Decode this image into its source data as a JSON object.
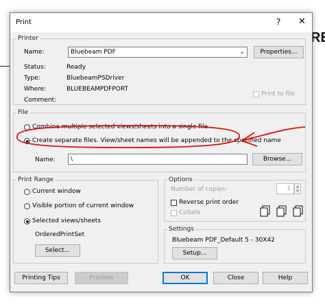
{
  "background": {
    "heading_fragment": "RE"
  },
  "dialog": {
    "title": "Print",
    "help_glyph": "?",
    "close_glyph": "✕"
  },
  "printer": {
    "legend": "Printer",
    "name_label": "Name:",
    "name_value": "Bluebeam PDF",
    "properties_label": "Properties...",
    "status_label": "Status:",
    "status_value": "Ready",
    "type_label": "Type:",
    "type_value": "BluebeamPSDriver",
    "where_label": "Where:",
    "where_value": "BLUEBEAMPDFPORT",
    "comment_label": "Comment:",
    "print_to_file_label": "Print to file"
  },
  "file": {
    "legend": "File",
    "combine_label": "Combine multiple selected views/sheets into a single file",
    "separate_label": "Create separate files. View/sheet names will be appended to the specified name",
    "selected": "separate",
    "path_value": "\\",
    "name_field_label": "Name:",
    "browse_label": "Browse...",
    "annotation_color": "#e01010"
  },
  "print_range": {
    "legend": "Print Range",
    "current_window": "Current window",
    "visible_portion": "Visible portion of current window",
    "selected_views": "Selected views/sheets",
    "selected": "selected_views",
    "set_name": "OrderedPrintSet",
    "select_label": "Select..."
  },
  "options": {
    "legend": "Options",
    "copies_label": "Number of copies:",
    "copies_value": "1",
    "reverse_label": "Reverse print order",
    "collate_label": "Collate"
  },
  "settings": {
    "legend": "Settings",
    "value": "Bluebeam PDF_Default 5 - 30X42",
    "setup_label": "Setup..."
  },
  "footer": {
    "printing_tips": "Printing Tips",
    "preview": "Preview",
    "ok": "OK",
    "close": "Close",
    "help": "Help"
  },
  "colors": {
    "accent": "#0078d7",
    "annotation": "#e01010",
    "dialog_bg": "#f0f0f0"
  }
}
